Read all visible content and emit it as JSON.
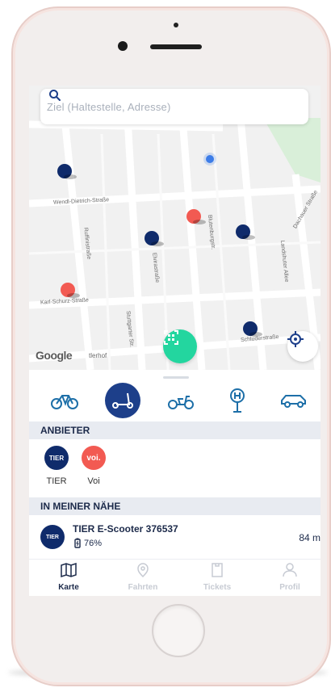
{
  "search": {
    "placeholder": "Ziel (Haltestelle, Adresse)"
  },
  "map": {
    "streets": [
      "Wendl-Dietrich-Straße",
      "Karl-Schurz-Straße",
      "Schluderstraße",
      "Dachauer Straße"
    ],
    "side_streets": [
      "Ruffinistraße",
      "Elvirastraße",
      "Blutenburgstr.",
      "Landshuter Allee",
      "Stuttgarter Str."
    ],
    "place_label": "tlerhof",
    "attribution": "Google",
    "markers": [
      {
        "provider": "TIER"
      },
      {
        "provider": "Voi"
      },
      {
        "provider": "TIER"
      },
      {
        "provider": "TIER"
      },
      {
        "provider": "Voi"
      },
      {
        "provider": "TIER"
      }
    ]
  },
  "modes": [
    {
      "name": "bike",
      "icon": "bicycle-icon",
      "active": false
    },
    {
      "name": "scooter",
      "icon": "kick-scooter-icon",
      "active": true
    },
    {
      "name": "moped",
      "icon": "moped-icon",
      "active": false
    },
    {
      "name": "transit",
      "icon": "bus-stop-icon",
      "active": false
    },
    {
      "name": "car",
      "icon": "car-icon",
      "active": false
    }
  ],
  "sections": {
    "providers": "ANBIETER",
    "nearby": "IN MEINER NÄHE"
  },
  "providers": [
    {
      "name": "TIER",
      "logo_text": "TIER",
      "color": "#0f2b6b"
    },
    {
      "name": "Voi",
      "logo_text": "voi.",
      "color": "#f25a52"
    }
  ],
  "nearby": [
    {
      "title": "TIER E-Scooter 376537",
      "battery": "76%",
      "distance": "84 m",
      "logo_text": "TIER"
    }
  ],
  "tabs": [
    {
      "label": "Karte",
      "icon": "map-icon",
      "active": true
    },
    {
      "label": "Fahrten",
      "icon": "location-pin-icon",
      "active": false
    },
    {
      "label": "Tickets",
      "icon": "ticket-icon",
      "active": false
    },
    {
      "label": "Profil",
      "icon": "person-icon",
      "active": false
    }
  ],
  "colors": {
    "accent": "#1d3f8a",
    "scan": "#23d69f",
    "tier": "#0f2b6b",
    "voi": "#f25a52"
  }
}
